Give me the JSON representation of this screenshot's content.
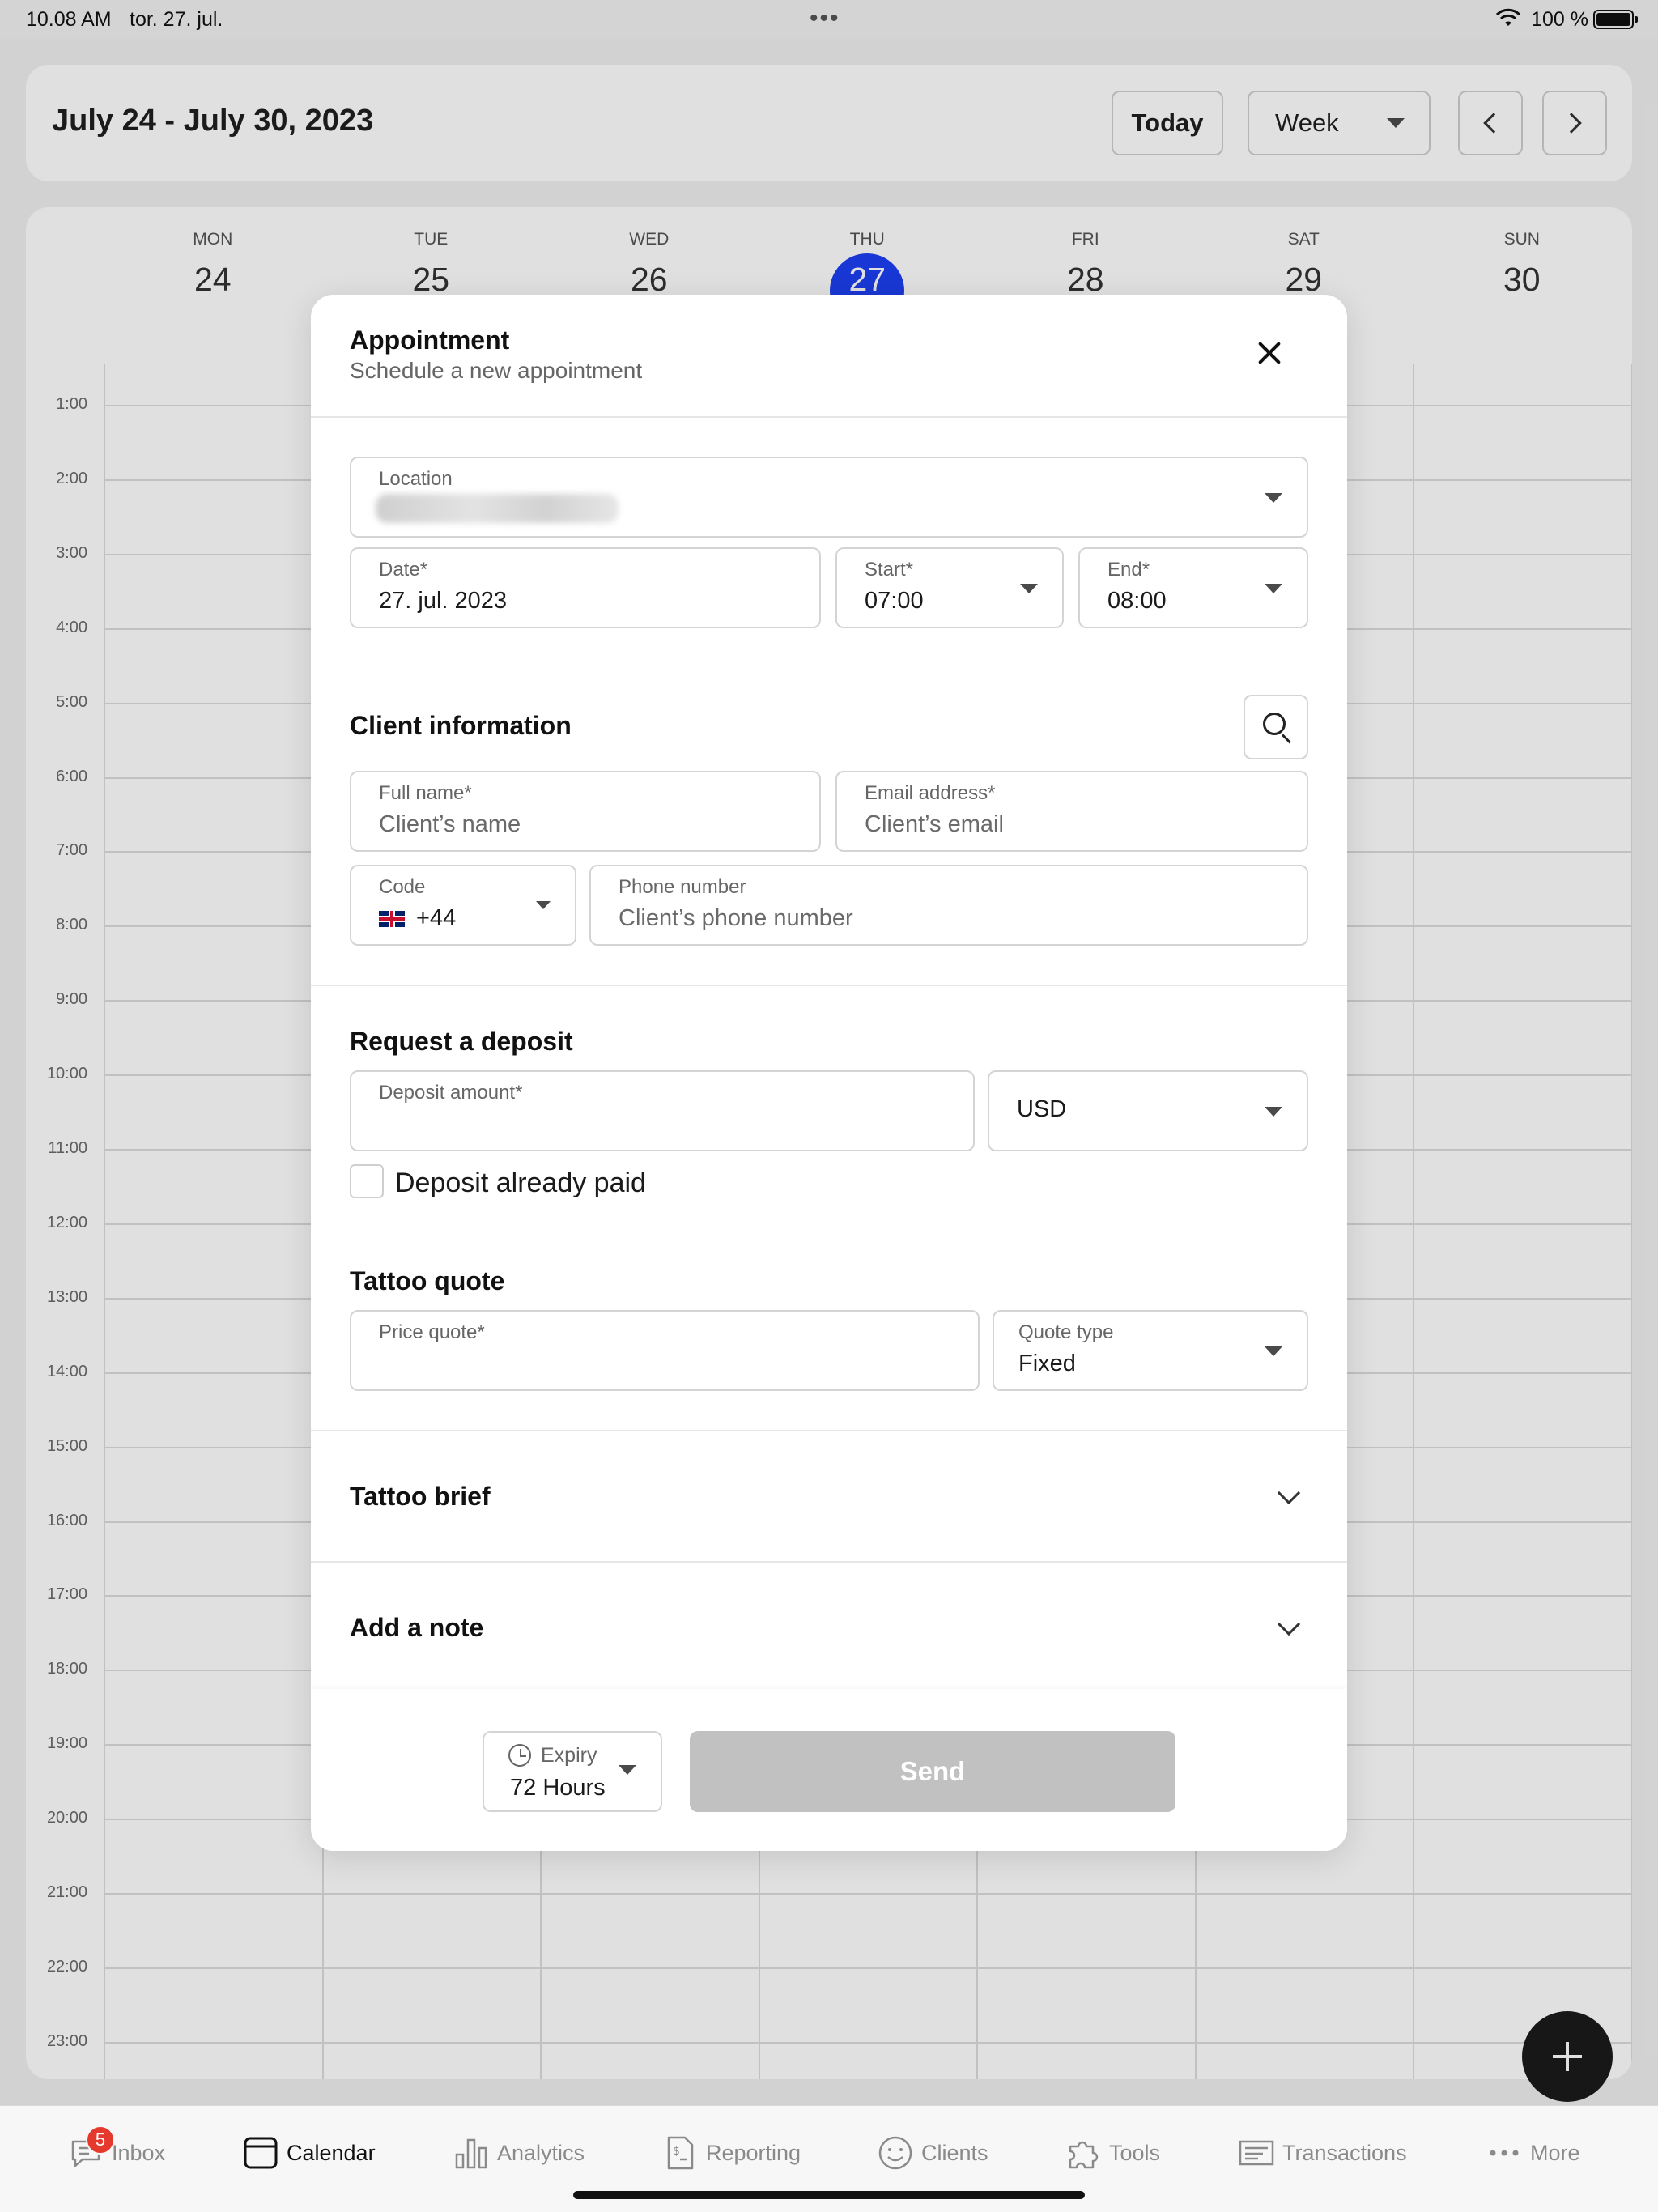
{
  "status_bar": {
    "time": "10.08 AM",
    "date": "tor. 27. jul.",
    "battery": "100 %"
  },
  "header": {
    "range_title": "July 24 - July 30, 2023",
    "today_label": "Today",
    "view_select": "Week"
  },
  "calendar": {
    "days": [
      {
        "dow": "MON",
        "num": "24"
      },
      {
        "dow": "TUE",
        "num": "25"
      },
      {
        "dow": "WED",
        "num": "26"
      },
      {
        "dow": "THU",
        "num": "27"
      },
      {
        "dow": "FRI",
        "num": "28"
      },
      {
        "dow": "SAT",
        "num": "29"
      },
      {
        "dow": "SUN",
        "num": "30"
      }
    ],
    "today_index": 3,
    "hours": [
      "1:00",
      "2:00",
      "3:00",
      "4:00",
      "5:00",
      "6:00",
      "7:00",
      "8:00",
      "9:00",
      "10:00",
      "11:00",
      "12:00",
      "13:00",
      "14:00",
      "15:00",
      "16:00",
      "17:00",
      "18:00",
      "19:00",
      "20:00",
      "21:00",
      "22:00",
      "23:00"
    ],
    "accent": "#1d3ff2"
  },
  "modal": {
    "title": "Appointment",
    "subtitle": "Schedule a new appointment",
    "location": {
      "label": "Location"
    },
    "date": {
      "label": "Date*",
      "value": "27. jul. 2023"
    },
    "start": {
      "label": "Start*",
      "value": "07:00"
    },
    "end": {
      "label": "End*",
      "value": "08:00"
    },
    "client": {
      "title": "Client information",
      "full_name": {
        "label": "Full name*",
        "placeholder": "Client’s name"
      },
      "email": {
        "label": "Email address*",
        "placeholder": "Client’s email"
      },
      "code": {
        "label": "Code",
        "value": "+44"
      },
      "phone": {
        "label": "Phone number",
        "placeholder": "Client’s phone number"
      }
    },
    "deposit": {
      "title": "Request a deposit",
      "amount_label": "Deposit amount*",
      "currency": "USD",
      "already_paid": "Deposit already paid"
    },
    "quote": {
      "title": "Tattoo quote",
      "price_label": "Price quote*",
      "type_label": "Quote type",
      "type_value": "Fixed"
    },
    "brief_title": "Tattoo brief",
    "note_title": "Add a note",
    "expiry": {
      "label": "Expiry",
      "value": "72 Hours"
    },
    "send_label": "Send"
  },
  "tabbar": {
    "items": [
      {
        "label": "Inbox",
        "icon": "chat-bubble-icon",
        "badge": "5"
      },
      {
        "label": "Calendar",
        "icon": "calendar-icon"
      },
      {
        "label": "Analytics",
        "icon": "bar-chart-icon"
      },
      {
        "label": "Reporting",
        "icon": "document-dollar-icon"
      },
      {
        "label": "Clients",
        "icon": "smiley-icon"
      },
      {
        "label": "Tools",
        "icon": "puzzle-icon"
      },
      {
        "label": "Transactions",
        "icon": "receipt-icon"
      },
      {
        "label": "More",
        "icon": "more-dots-icon"
      }
    ],
    "active": "Calendar"
  }
}
